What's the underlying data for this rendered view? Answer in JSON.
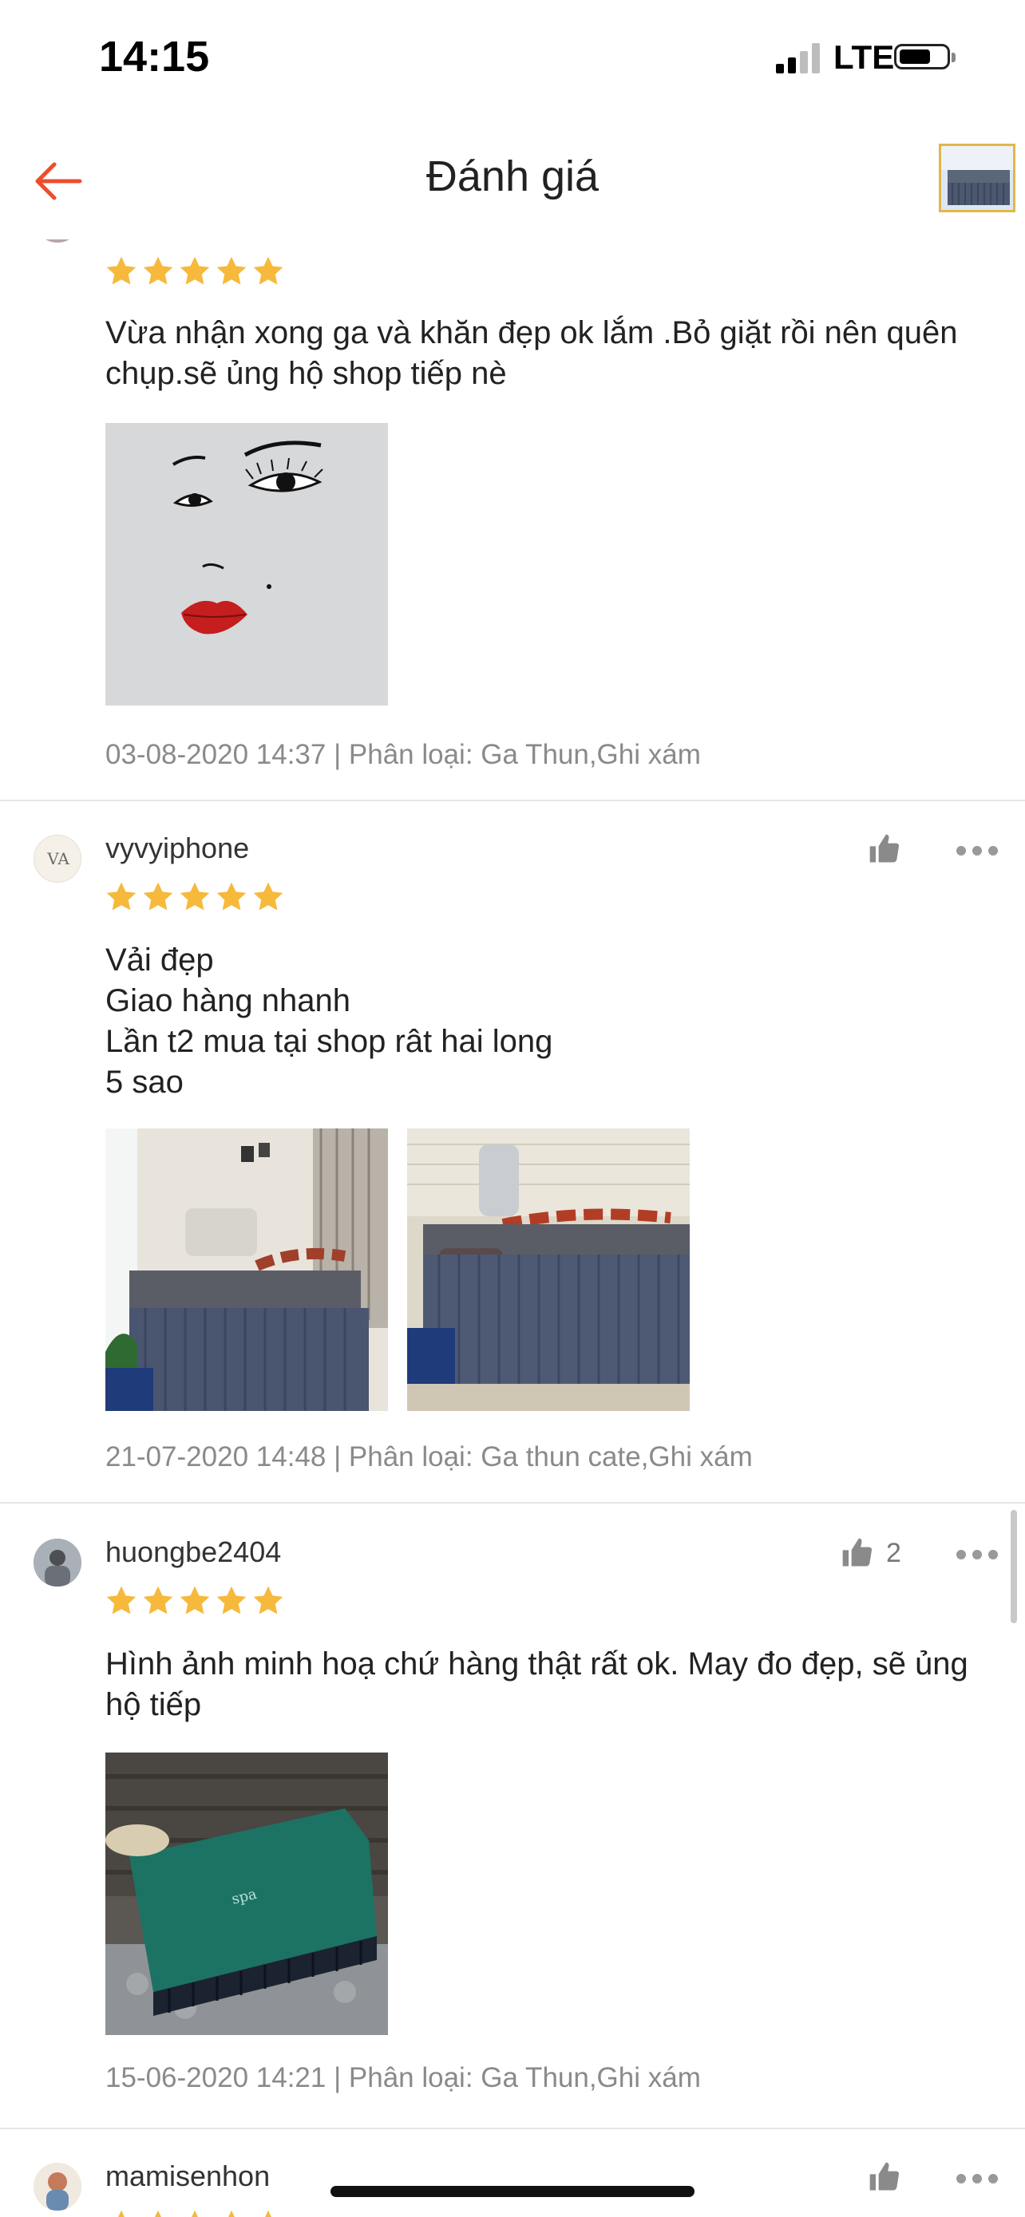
{
  "status_bar": {
    "time": "14:15",
    "network": "LTE"
  },
  "header": {
    "title": "Đánh giá",
    "back_icon": "arrow-left-icon",
    "product_thumbnail": "product-thumbnail"
  },
  "colors": {
    "accent": "#ee4d2d",
    "star": "#f6b93b",
    "muted_text": "#8a8a8a"
  },
  "reviews": [
    {
      "username": "",
      "rating": 5,
      "text": "Vừa nhận xong ga và khăn đẹp ok lắm .Bỏ giặt rồi nên quên chụp.sẽ ủng hộ shop tiếp nè",
      "meta": "03-08-2020 14:37 | Phân loại: Ga Thun,Ghi xám",
      "photos": [
        "face-drawing-photo"
      ]
    },
    {
      "username": "vyvyiphone",
      "rating": 5,
      "text_lines": [
        "Vải đẹp",
        "Giao hàng nhanh",
        "Lần t2 mua tại shop rât hai long",
        "5 sao"
      ],
      "meta": "21-07-2020 14:48 | Phân loại: Ga thun cate,Ghi xám",
      "photos": [
        "spa-bed-photo",
        "bed-skirt-photo"
      ],
      "likes": ""
    },
    {
      "username": "huongbe2404",
      "rating": 5,
      "text": "Hình ảnh minh hoạ chứ hàng thật rất ok. May đo đẹp, sẽ ủng hộ tiếp",
      "meta": "15-06-2020 14:21 | Phân loại: Ga Thun,Ghi xám",
      "photos": [
        "green-towel-bed-photo"
      ],
      "likes": "2"
    },
    {
      "username": "mamisenhon",
      "rating": 5,
      "likes": ""
    }
  ]
}
